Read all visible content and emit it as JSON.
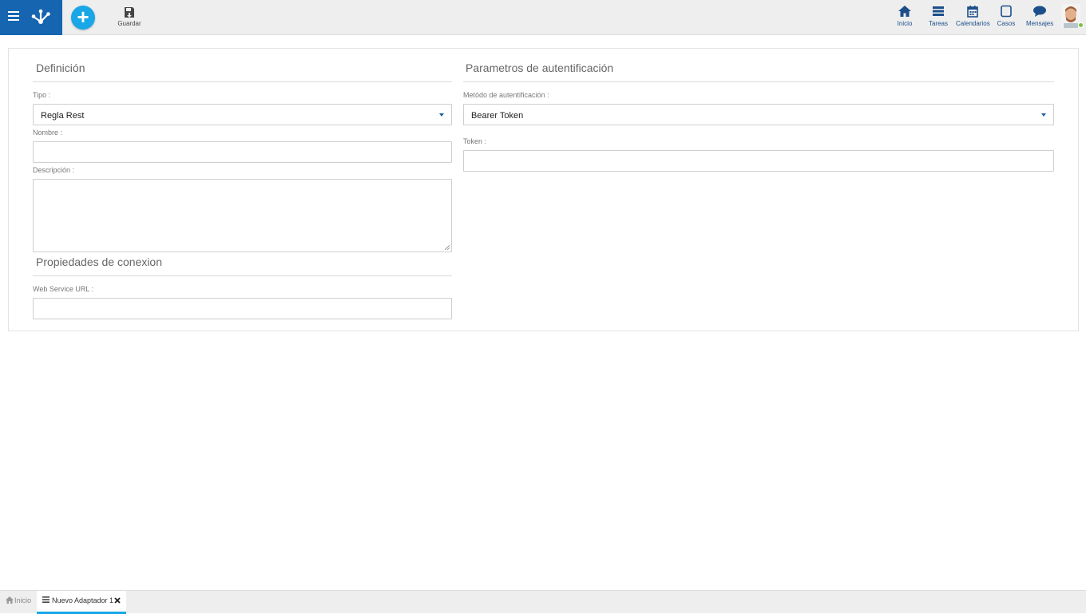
{
  "toolbar": {
    "save_label": "Guardar"
  },
  "nav": {
    "home_label": "Inicio",
    "tasks_label": "Tareas",
    "calendars_label": "Calendarios",
    "cases_label": "Casos",
    "messages_label": "Mensajes"
  },
  "definition": {
    "title": "Definición",
    "tipo_label": "Tipo :",
    "tipo_value": "Regla Rest",
    "nombre_label": "Nombre :",
    "nombre_value": "",
    "descripcion_label": "Descripción :",
    "descripcion_value": ""
  },
  "connection": {
    "title": "Propiedades de conexion",
    "url_label": "Web Service URL :",
    "url_value": ""
  },
  "auth": {
    "title": "Parametros de autentificación",
    "method_label": "Metódo de autentificación :",
    "method_value": "Bearer Token",
    "token_label": "Token :",
    "token_value": ""
  },
  "tabs": [
    {
      "label": "Inicio",
      "active": false
    },
    {
      "label": "Nuevo Adaptador 1",
      "active": true
    }
  ],
  "colors": {
    "brand_blue": "#1565b0",
    "accent_cyan": "#19a7e7",
    "nav_icon": "#1c4f8a"
  },
  "icons": [
    "menu-icon",
    "app-logo-icon",
    "plus-icon",
    "save-icon",
    "home-icon",
    "tasks-icon",
    "calendar-icon",
    "cases-icon",
    "messages-icon",
    "close-icon",
    "tab-list-icon"
  ]
}
